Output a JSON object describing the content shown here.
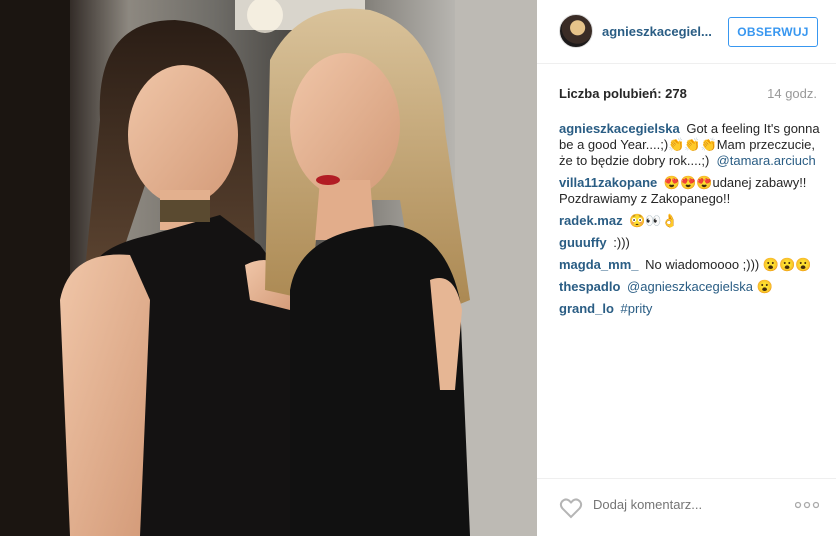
{
  "post": {
    "photo_alt": "",
    "author": "agnieszkacegiel...",
    "follow_label": "OBSERWUJ",
    "likes_text": "Liczba polubień: 278",
    "time_text": "14 godz."
  },
  "comments": [
    {
      "user": "agnieszkacegielska",
      "text": "Got a feeling It's gonna be a good Year....;)👏👏👏Mam przeczucie, że to będzie dobry rok....;) ",
      "link": "@tamara.arciuch"
    },
    {
      "user": "villa11zakopane",
      "text": "😍😍😍udanej zabawy!! Pozdrawiamy z Zakopanego!!",
      "link": ""
    },
    {
      "user": "radek.maz",
      "text": "😳👀👌",
      "link": ""
    },
    {
      "user": "guuuffy",
      "text": ":)))",
      "link": ""
    },
    {
      "user": "magda_mm_",
      "text": "No wiadomoooo ;))) 😮😮😮",
      "link": ""
    },
    {
      "user": "thespadlo",
      "text": "",
      "link": "@agnieszkacegielska 😮"
    },
    {
      "user": "grand_lo",
      "text": "",
      "link": "#prity"
    }
  ],
  "footer": {
    "comment_placeholder": "Dodaj komentarz...",
    "like_icon": "heart-icon",
    "more_icon": "more-options-icon"
  },
  "colors": {
    "link": "#2a5d84",
    "follow": "#3897f0",
    "muted": "#999999",
    "text": "#262626"
  }
}
